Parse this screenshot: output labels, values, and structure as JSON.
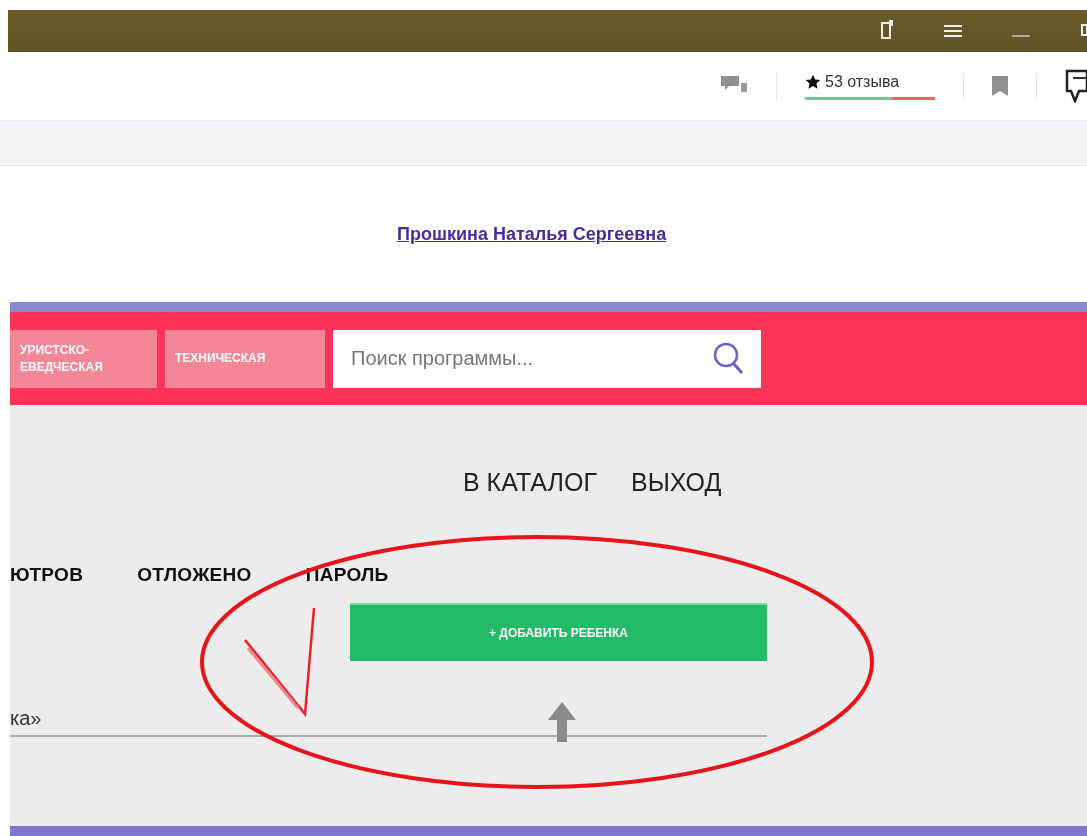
{
  "toolbar": {
    "reviews": "53 отзыва"
  },
  "profile": {
    "name": "Прошкина Наталья Сергеевна"
  },
  "categories": [
    {
      "lines": [
        "УРИСТСКО-",
        "ЕВЕДЧЕСКАЯ"
      ]
    },
    {
      "lines": [
        "ТЕХНИЧЕСКАЯ"
      ]
    }
  ],
  "search": {
    "placeholder": "Поиск программы..."
  },
  "nav_links": [
    "В КАТАЛОГ",
    "ВЫХОД"
  ],
  "tabs": [
    "ЮТРОВ",
    "ОТЛОЖЕНО",
    "ПАРОЛЬ"
  ],
  "add_button": "+ ДОБАВИТЬ РЕБЕНКА",
  "field_text": "ка»"
}
